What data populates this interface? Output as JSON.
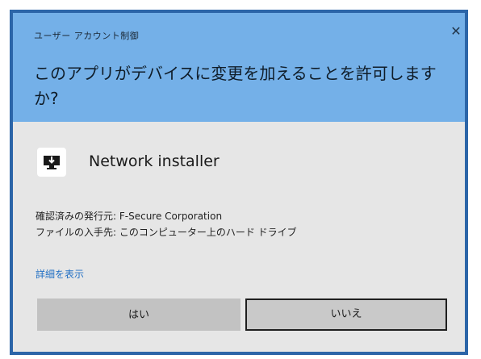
{
  "colors": {
    "frame": "#2c65a8",
    "header_bg": "#74b0e8",
    "body_bg": "#e6e6e6",
    "link": "#2270c4",
    "button_bg": "#c2c2c2"
  },
  "header": {
    "title": "ユーザー アカウント制御",
    "close_glyph": "✕",
    "question": "このアプリがデバイスに変更を加えることを許可しますか?"
  },
  "app": {
    "icon": "download-icon",
    "name": "Network installer"
  },
  "info": {
    "publisher": "確認済みの発行元: F-Secure Corporation",
    "origin": "ファイルの入手先: このコンピューター上のハード ドライブ"
  },
  "details_link": "詳細を表示",
  "buttons": {
    "yes": "はい",
    "no": "いいえ"
  }
}
